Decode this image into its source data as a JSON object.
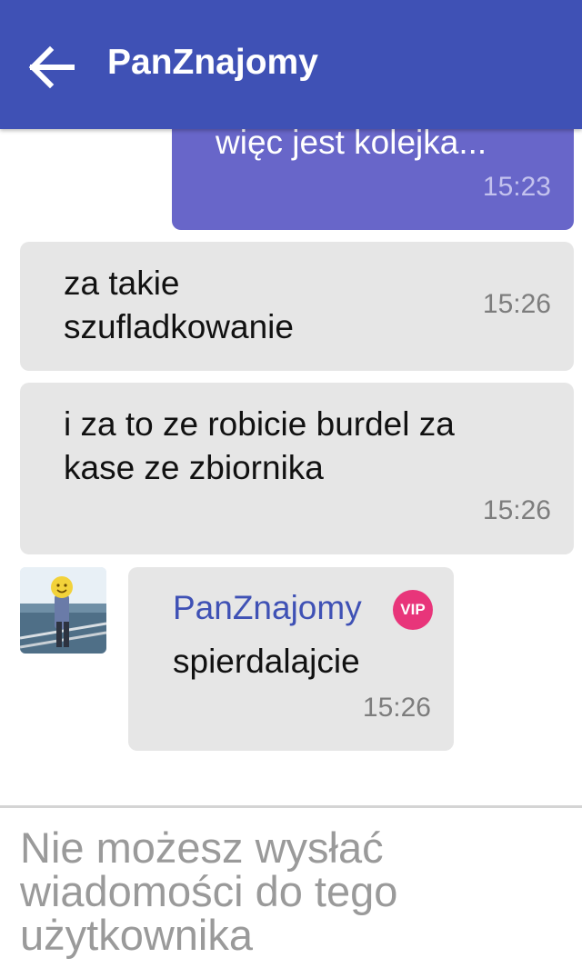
{
  "header": {
    "title": "PanZnajomy",
    "back_icon": "arrow-left-icon"
  },
  "messages": [
    {
      "direction": "outgoing",
      "text": "więc jest kolejka...",
      "time": "15:23"
    },
    {
      "direction": "incoming",
      "text": "za takie\nszufladkowanie",
      "time": "15:26"
    },
    {
      "direction": "incoming",
      "text": "i za to ze robicie burdel za\nkase ze zbiornika",
      "time": "15:26"
    },
    {
      "direction": "incoming",
      "sender": "PanZnajomy",
      "badge": "VIP",
      "text": "spierdalajcie",
      "time": "15:26"
    }
  ],
  "composer": {
    "notice": "Nie możesz wysłać\nwiadomości do tego\nużytkownika"
  },
  "colors": {
    "header_bg": "#3f51b5",
    "outgoing_bubble": "#6866c9",
    "incoming_bubble": "#e6e6e6",
    "vip_badge": "#e8357a",
    "sender_name": "#3f51b5"
  }
}
